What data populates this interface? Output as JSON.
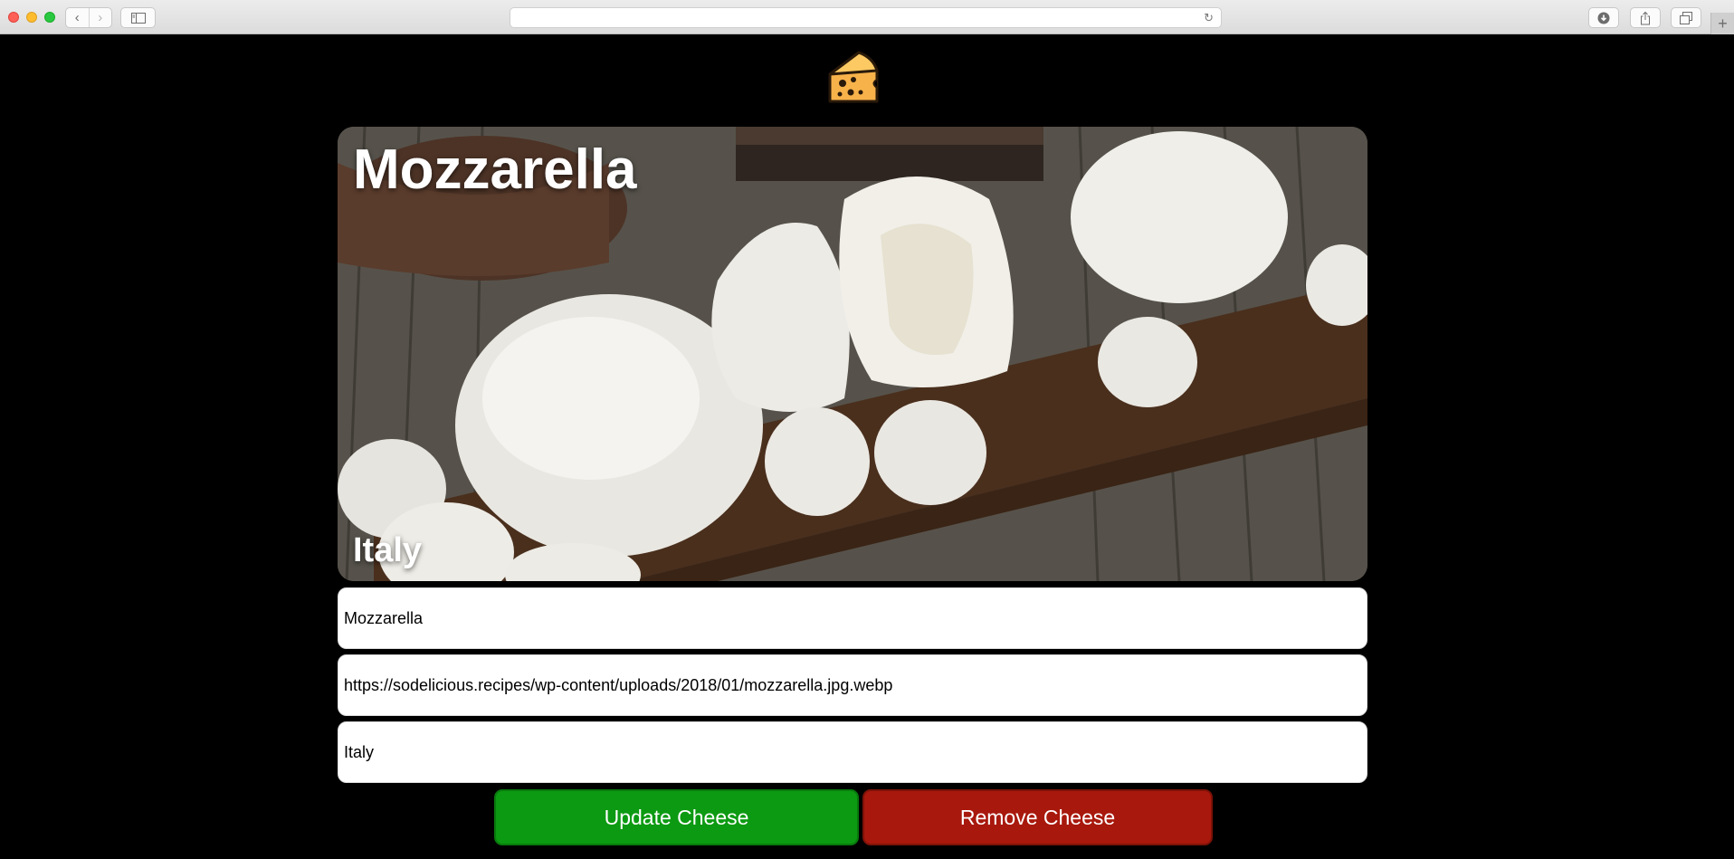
{
  "browser": {
    "url": "",
    "icons": [
      "back-icon",
      "forward-icon",
      "sidebar-icon",
      "reload-icon",
      "download-icon",
      "share-icon",
      "tabs-icon",
      "new-tab-icon"
    ]
  },
  "app": {
    "logo_icon": "cheese-icon"
  },
  "card": {
    "title": "Mozzarella",
    "origin": "Italy",
    "image": "mozzarella-photo"
  },
  "form": {
    "name_value": "Mozzarella",
    "image_url_value": "https://sodelicious.recipes/wp-content/uploads/2018/01/mozzarella.jpg.webp",
    "origin_value": "Italy"
  },
  "buttons": {
    "update_label": "Update Cheese",
    "remove_label": "Remove Cheese"
  },
  "colors": {
    "update": "#0c9a12",
    "remove": "#a8180c",
    "background": "#000000"
  }
}
